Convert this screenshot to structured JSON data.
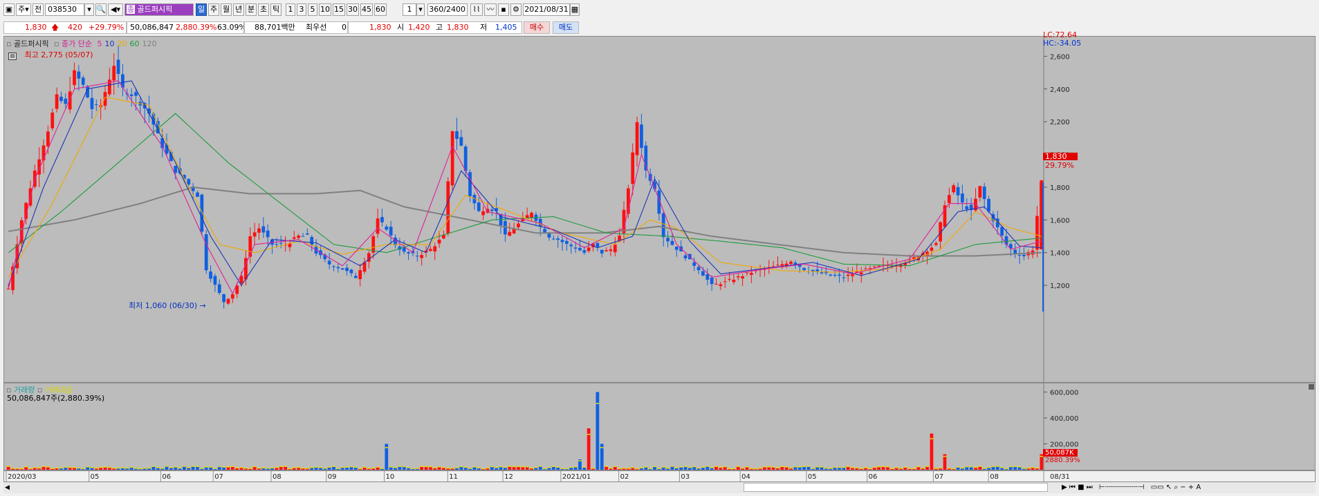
{
  "toolbar": {
    "period_label": "주",
    "all_label": "전",
    "code": "038530",
    "stock_name": "골드퍼시픽",
    "period_buttons": [
      "일",
      "주",
      "월",
      "년",
      "분",
      "초",
      "틱"
    ],
    "selected_period": "일",
    "interval_buttons": [
      "1",
      "3",
      "5",
      "10",
      "15",
      "30",
      "45",
      "60"
    ],
    "interval_value": "1",
    "count": "360",
    "count_total": "/2400",
    "date": "2021/08/31"
  },
  "quote": {
    "price": "1,830",
    "change": "420",
    "change_pct": "+29.79%",
    "volume": "50,086,847",
    "volume_pct": "2,880.39%",
    "ratio": "63.09%",
    "amount": "88,701백만",
    "pref_label": "최우선",
    "pref_value": "0",
    "pref_price": "1,830",
    "open_label": "시",
    "open": "1,420",
    "high_label": "고",
    "high": "1,830",
    "low_label": "저",
    "low": "1,405",
    "buy_label": "매수",
    "sell_label": "매도"
  },
  "legend": {
    "name": "골드퍼시픽",
    "ma_label": "종가 단순",
    "ma_periods": [
      "5",
      "10",
      "20",
      "60",
      "120"
    ],
    "ma_colors": [
      "#e0209a",
      "#1a35b8",
      "#f0a800",
      "#1e9a3a",
      "#808080"
    ],
    "high_note": "최고 2,775 (05/07)",
    "low_note": "최저 1,060 (06/30)",
    "lc": "LC:72.64",
    "hc": "HC:-34.05"
  },
  "volume_legend": {
    "label1": "거래량",
    "label2": "거래대금",
    "value": "50,086,847주(2,880.39%)",
    "badge1": "50,087K",
    "badge2": "2880.39%"
  },
  "price_badge": {
    "price": "1,830",
    "pct": "29.79%"
  },
  "chart_data": {
    "type": "candlestick",
    "price_ticks": [
      1200,
      1400,
      1600,
      1800,
      2000,
      2200,
      2400,
      2600
    ],
    "price_tick_labels": [
      "1,200",
      "1,400",
      "1,600",
      "1,800",
      "2,000",
      "2,200",
      "2,400",
      "2,600"
    ],
    "volume_ticks": [
      200000,
      400000,
      600000
    ],
    "volume_tick_labels": [
      "200,000",
      "400,000",
      "600,000"
    ],
    "x_labels": [
      "2020/03",
      "05",
      "06",
      "07",
      "08",
      "09",
      "10",
      "11",
      "12",
      "2021/01",
      "02",
      "03",
      "04",
      "05",
      "06",
      "07",
      "08"
    ],
    "last_label": "08/31",
    "ylim": [
      1040,
      2720
    ],
    "close_path": [
      [
        0,
        1180
      ],
      [
        3,
        1600
      ],
      [
        6,
        1900
      ],
      [
        9,
        2150
      ],
      [
        11,
        2350
      ],
      [
        13,
        2300
      ],
      [
        15,
        2500
      ],
      [
        17,
        2420
      ],
      [
        19,
        2280
      ],
      [
        21,
        2300
      ],
      [
        24,
        2550
      ],
      [
        26,
        2400
      ],
      [
        29,
        2350
      ],
      [
        32,
        2250
      ],
      [
        35,
        2050
      ],
      [
        38,
        1900
      ],
      [
        40,
        1850
      ],
      [
        43,
        1750
      ],
      [
        45,
        1300
      ],
      [
        47,
        1200
      ],
      [
        49,
        1100
      ],
      [
        51,
        1150
      ],
      [
        53,
        1250
      ],
      [
        55,
        1500
      ],
      [
        57,
        1550
      ],
      [
        60,
        1450
      ],
      [
        63,
        1450
      ],
      [
        66,
        1500
      ],
      [
        68,
        1500
      ],
      [
        70,
        1400
      ],
      [
        73,
        1330
      ],
      [
        76,
        1300
      ],
      [
        79,
        1250
      ],
      [
        82,
        1400
      ],
      [
        84,
        1600
      ],
      [
        86,
        1550
      ],
      [
        88,
        1450
      ],
      [
        90,
        1400
      ],
      [
        93,
        1380
      ],
      [
        96,
        1420
      ],
      [
        99,
        1500
      ],
      [
        101,
        2150
      ],
      [
        103,
        2050
      ],
      [
        105,
        1750
      ],
      [
        107,
        1650
      ],
      [
        109,
        1680
      ],
      [
        111,
        1650
      ],
      [
        113,
        1500
      ],
      [
        115,
        1550
      ],
      [
        117,
        1600
      ],
      [
        119,
        1650
      ],
      [
        121,
        1560
      ],
      [
        123,
        1500
      ],
      [
        125,
        1480
      ],
      [
        127,
        1450
      ],
      [
        129,
        1430
      ],
      [
        131,
        1400
      ],
      [
        133,
        1450
      ],
      [
        135,
        1400
      ],
      [
        137,
        1420
      ],
      [
        139,
        1500
      ],
      [
        141,
        1800
      ],
      [
        143,
        2200
      ],
      [
        145,
        1900
      ],
      [
        147,
        1800
      ],
      [
        149,
        1500
      ],
      [
        151,
        1450
      ],
      [
        153,
        1400
      ],
      [
        155,
        1350
      ],
      [
        157,
        1300
      ],
      [
        160,
        1200
      ],
      [
        163,
        1220
      ],
      [
        166,
        1250
      ],
      [
        169,
        1280
      ],
      [
        172,
        1300
      ],
      [
        175,
        1320
      ],
      [
        178,
        1350
      ],
      [
        181,
        1300
      ],
      [
        184,
        1280
      ],
      [
        187,
        1260
      ],
      [
        190,
        1250
      ],
      [
        193,
        1280
      ],
      [
        196,
        1300
      ],
      [
        199,
        1320
      ],
      [
        202,
        1330
      ],
      [
        205,
        1350
      ],
      [
        208,
        1400
      ],
      [
        211,
        1450
      ],
      [
        213,
        1700
      ],
      [
        215,
        1800
      ],
      [
        217,
        1700
      ],
      [
        219,
        1650
      ],
      [
        221,
        1800
      ],
      [
        223,
        1650
      ],
      [
        225,
        1550
      ],
      [
        227,
        1450
      ],
      [
        229,
        1400
      ],
      [
        231,
        1380
      ],
      [
        233,
        1420
      ],
      [
        235,
        1830
      ]
    ],
    "ma_paths": {
      "5": [
        [
          0,
          1180
        ],
        [
          6,
          1850
        ],
        [
          15,
          2400
        ],
        [
          25,
          2450
        ],
        [
          35,
          2050
        ],
        [
          45,
          1450
        ],
        [
          51,
          1150
        ],
        [
          56,
          1450
        ],
        [
          66,
          1480
        ],
        [
          76,
          1320
        ],
        [
          84,
          1550
        ],
        [
          92,
          1400
        ],
        [
          101,
          2050
        ],
        [
          109,
          1650
        ],
        [
          121,
          1580
        ],
        [
          131,
          1430
        ],
        [
          140,
          1550
        ],
        [
          144,
          2000
        ],
        [
          152,
          1450
        ],
        [
          160,
          1250
        ],
        [
          172,
          1300
        ],
        [
          181,
          1330
        ],
        [
          192,
          1270
        ],
        [
          205,
          1360
        ],
        [
          214,
          1700
        ],
        [
          220,
          1700
        ],
        [
          228,
          1420
        ],
        [
          235,
          1470
        ]
      ],
      "10": [
        [
          0,
          1200
        ],
        [
          8,
          1800
        ],
        [
          18,
          2400
        ],
        [
          28,
          2450
        ],
        [
          38,
          1950
        ],
        [
          46,
          1500
        ],
        [
          53,
          1200
        ],
        [
          60,
          1480
        ],
        [
          70,
          1460
        ],
        [
          80,
          1320
        ],
        [
          88,
          1480
        ],
        [
          95,
          1400
        ],
        [
          103,
          1900
        ],
        [
          112,
          1620
        ],
        [
          124,
          1540
        ],
        [
          134,
          1430
        ],
        [
          142,
          1500
        ],
        [
          147,
          1850
        ],
        [
          155,
          1470
        ],
        [
          162,
          1270
        ],
        [
          174,
          1310
        ],
        [
          183,
          1340
        ],
        [
          194,
          1260
        ],
        [
          207,
          1360
        ],
        [
          216,
          1650
        ],
        [
          222,
          1680
        ],
        [
          230,
          1440
        ],
        [
          235,
          1430
        ]
      ],
      "20": [
        [
          0,
          1250
        ],
        [
          10,
          1700
        ],
        [
          22,
          2350
        ],
        [
          32,
          2300
        ],
        [
          40,
          1850
        ],
        [
          48,
          1450
        ],
        [
          56,
          1400
        ],
        [
          66,
          1470
        ],
        [
          76,
          1390
        ],
        [
          86,
          1450
        ],
        [
          96,
          1450
        ],
        [
          104,
          1750
        ],
        [
          114,
          1650
        ],
        [
          126,
          1520
        ],
        [
          138,
          1450
        ],
        [
          146,
          1600
        ],
        [
          152,
          1550
        ],
        [
          162,
          1340
        ],
        [
          176,
          1290
        ],
        [
          188,
          1280
        ],
        [
          200,
          1300
        ],
        [
          212,
          1420
        ],
        [
          220,
          1650
        ],
        [
          228,
          1550
        ],
        [
          235,
          1500
        ]
      ],
      "60": [
        [
          0,
          1400
        ],
        [
          12,
          1650
        ],
        [
          25,
          1950
        ],
        [
          38,
          2250
        ],
        [
          50,
          1950
        ],
        [
          62,
          1700
        ],
        [
          74,
          1450
        ],
        [
          86,
          1400
        ],
        [
          98,
          1500
        ],
        [
          110,
          1600
        ],
        [
          124,
          1620
        ],
        [
          136,
          1520
        ],
        [
          150,
          1500
        ],
        [
          162,
          1470
        ],
        [
          176,
          1430
        ],
        [
          190,
          1330
        ],
        [
          205,
          1320
        ],
        [
          220,
          1450
        ],
        [
          235,
          1490
        ]
      ],
      "120": [
        [
          0,
          1530
        ],
        [
          15,
          1600
        ],
        [
          30,
          1700
        ],
        [
          42,
          1800
        ],
        [
          55,
          1760
        ],
        [
          70,
          1760
        ],
        [
          80,
          1780
        ],
        [
          90,
          1680
        ],
        [
          105,
          1600
        ],
        [
          120,
          1520
        ],
        [
          135,
          1520
        ],
        [
          148,
          1560
        ],
        [
          160,
          1500
        ],
        [
          175,
          1450
        ],
        [
          190,
          1400
        ],
        [
          205,
          1380
        ],
        [
          220,
          1380
        ],
        [
          235,
          1400
        ]
      ]
    },
    "volume_spikes": [
      [
        36,
        30000
      ],
      [
        76,
        20000
      ],
      [
        86,
        200000
      ],
      [
        130,
        80000
      ],
      [
        132,
        320000
      ],
      [
        134,
        600000
      ],
      [
        135,
        200000
      ],
      [
        210,
        280000
      ],
      [
        213,
        120000
      ],
      [
        235,
        120000
      ]
    ]
  },
  "scroll_icons": [
    "prev-icon",
    "next-icon",
    "stop-icon",
    "zoom-in-icon",
    "zoom-out-icon"
  ]
}
